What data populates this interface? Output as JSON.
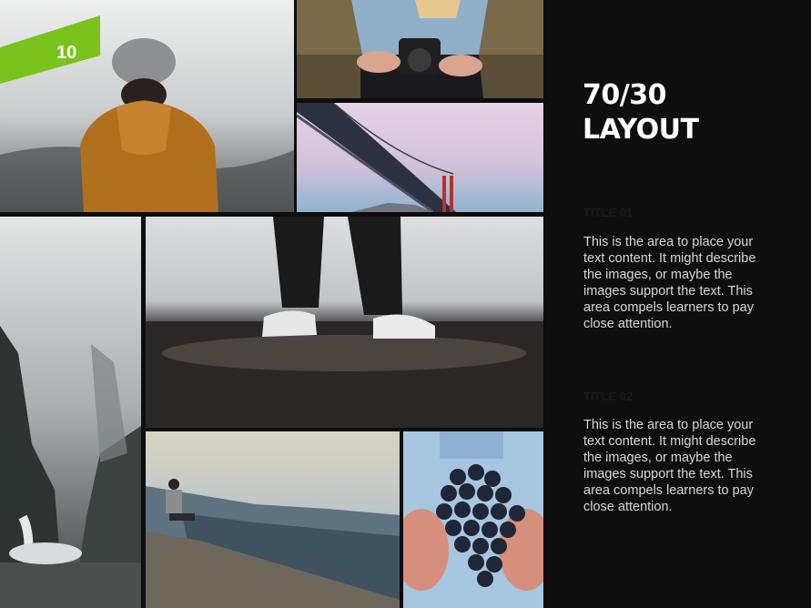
{
  "slide": {
    "badge_number": "10",
    "heading_line1": "70/30",
    "heading_line2": "LAYOUT",
    "section1_title": "TITLE 01",
    "section1_body": "This is the area to place your text content. It might describe the images, or maybe the images support the text. This area compels learners to pay close attention.",
    "section2_title": "TITLE 02",
    "section2_body": "This is the area to place your text content. It might describe the images, or maybe the images support the text. This area compels learners to pay close attention."
  },
  "colors": {
    "accent_green": "#7ac21c",
    "panel_background": "#0e0e0e",
    "heading_text": "#ffffff",
    "body_text": "#d8d8d8"
  }
}
